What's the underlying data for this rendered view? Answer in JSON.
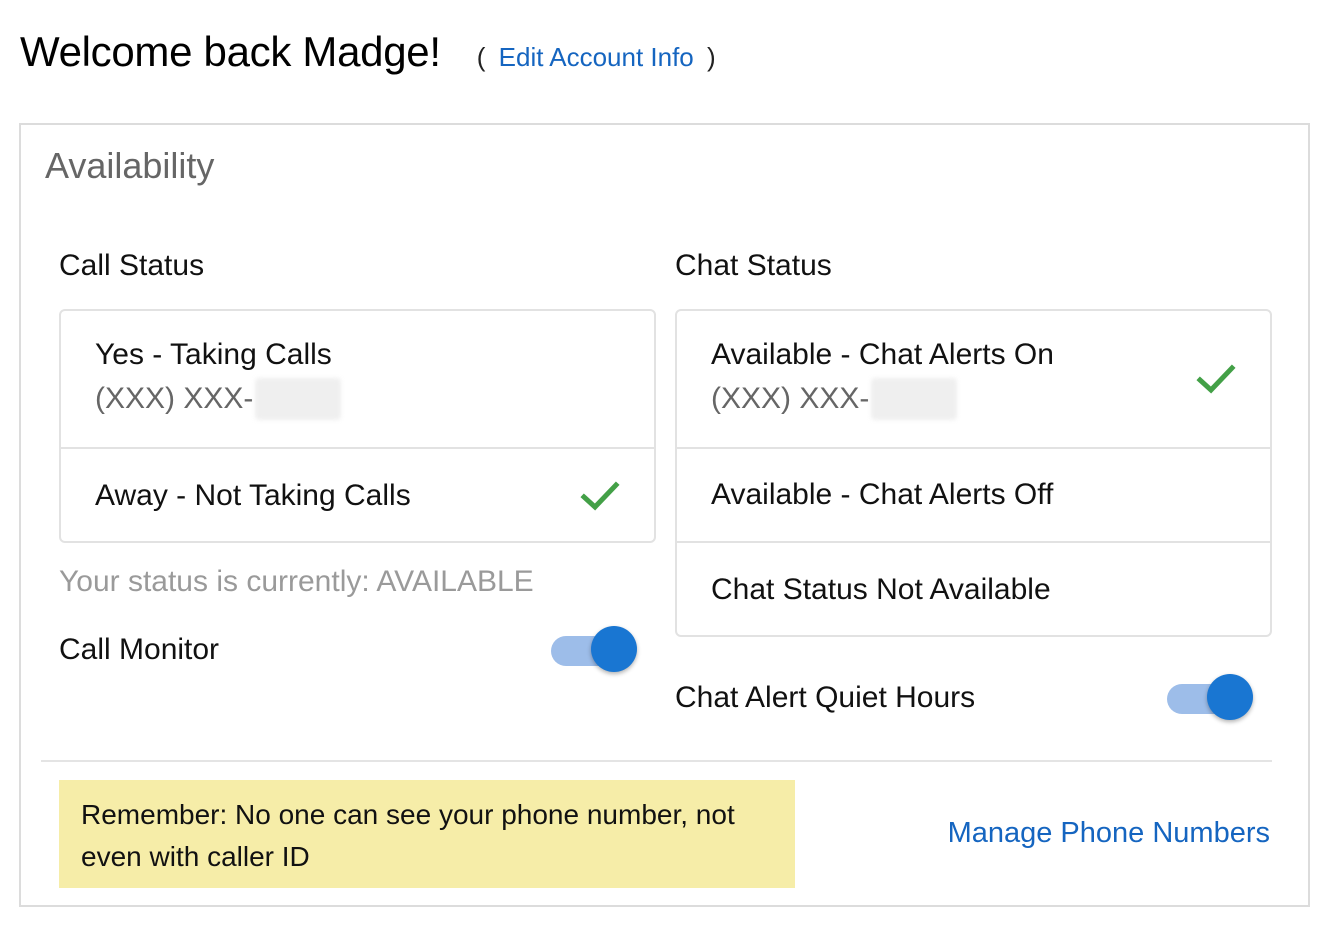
{
  "header": {
    "welcome": "Welcome back Madge!",
    "edit_open": "(",
    "edit_link": "Edit Account Info",
    "edit_close": ")"
  },
  "panel": {
    "title": "Availability"
  },
  "call_status": {
    "title": "Call Status",
    "options": [
      {
        "label": "Yes - Taking Calls",
        "phone": "(XXX) XXX-",
        "selected": false
      },
      {
        "label": "Away - Not Taking Calls",
        "selected": true
      }
    ],
    "status_text": "Your status is currently: AVAILABLE",
    "monitor_label": "Call Monitor",
    "monitor_on": true
  },
  "chat_status": {
    "title": "Chat Status",
    "options": [
      {
        "label": "Available - Chat Alerts On",
        "phone": "(XXX) XXX-",
        "selected": true
      },
      {
        "label": "Available - Chat Alerts Off",
        "selected": false
      },
      {
        "label": "Chat Status Not Available",
        "selected": false
      }
    ],
    "quiet_label": "Chat Alert Quiet Hours",
    "quiet_on": true
  },
  "footer": {
    "notice": "Remember: No one can see your phone number, not even with caller ID",
    "manage_link": "Manage Phone Numbers"
  },
  "colors": {
    "accent": "#1976d2",
    "link": "#1565c0",
    "check": "#43a047",
    "notice_bg": "#f6eda8"
  },
  "icons": {
    "selected": "check-icon"
  }
}
